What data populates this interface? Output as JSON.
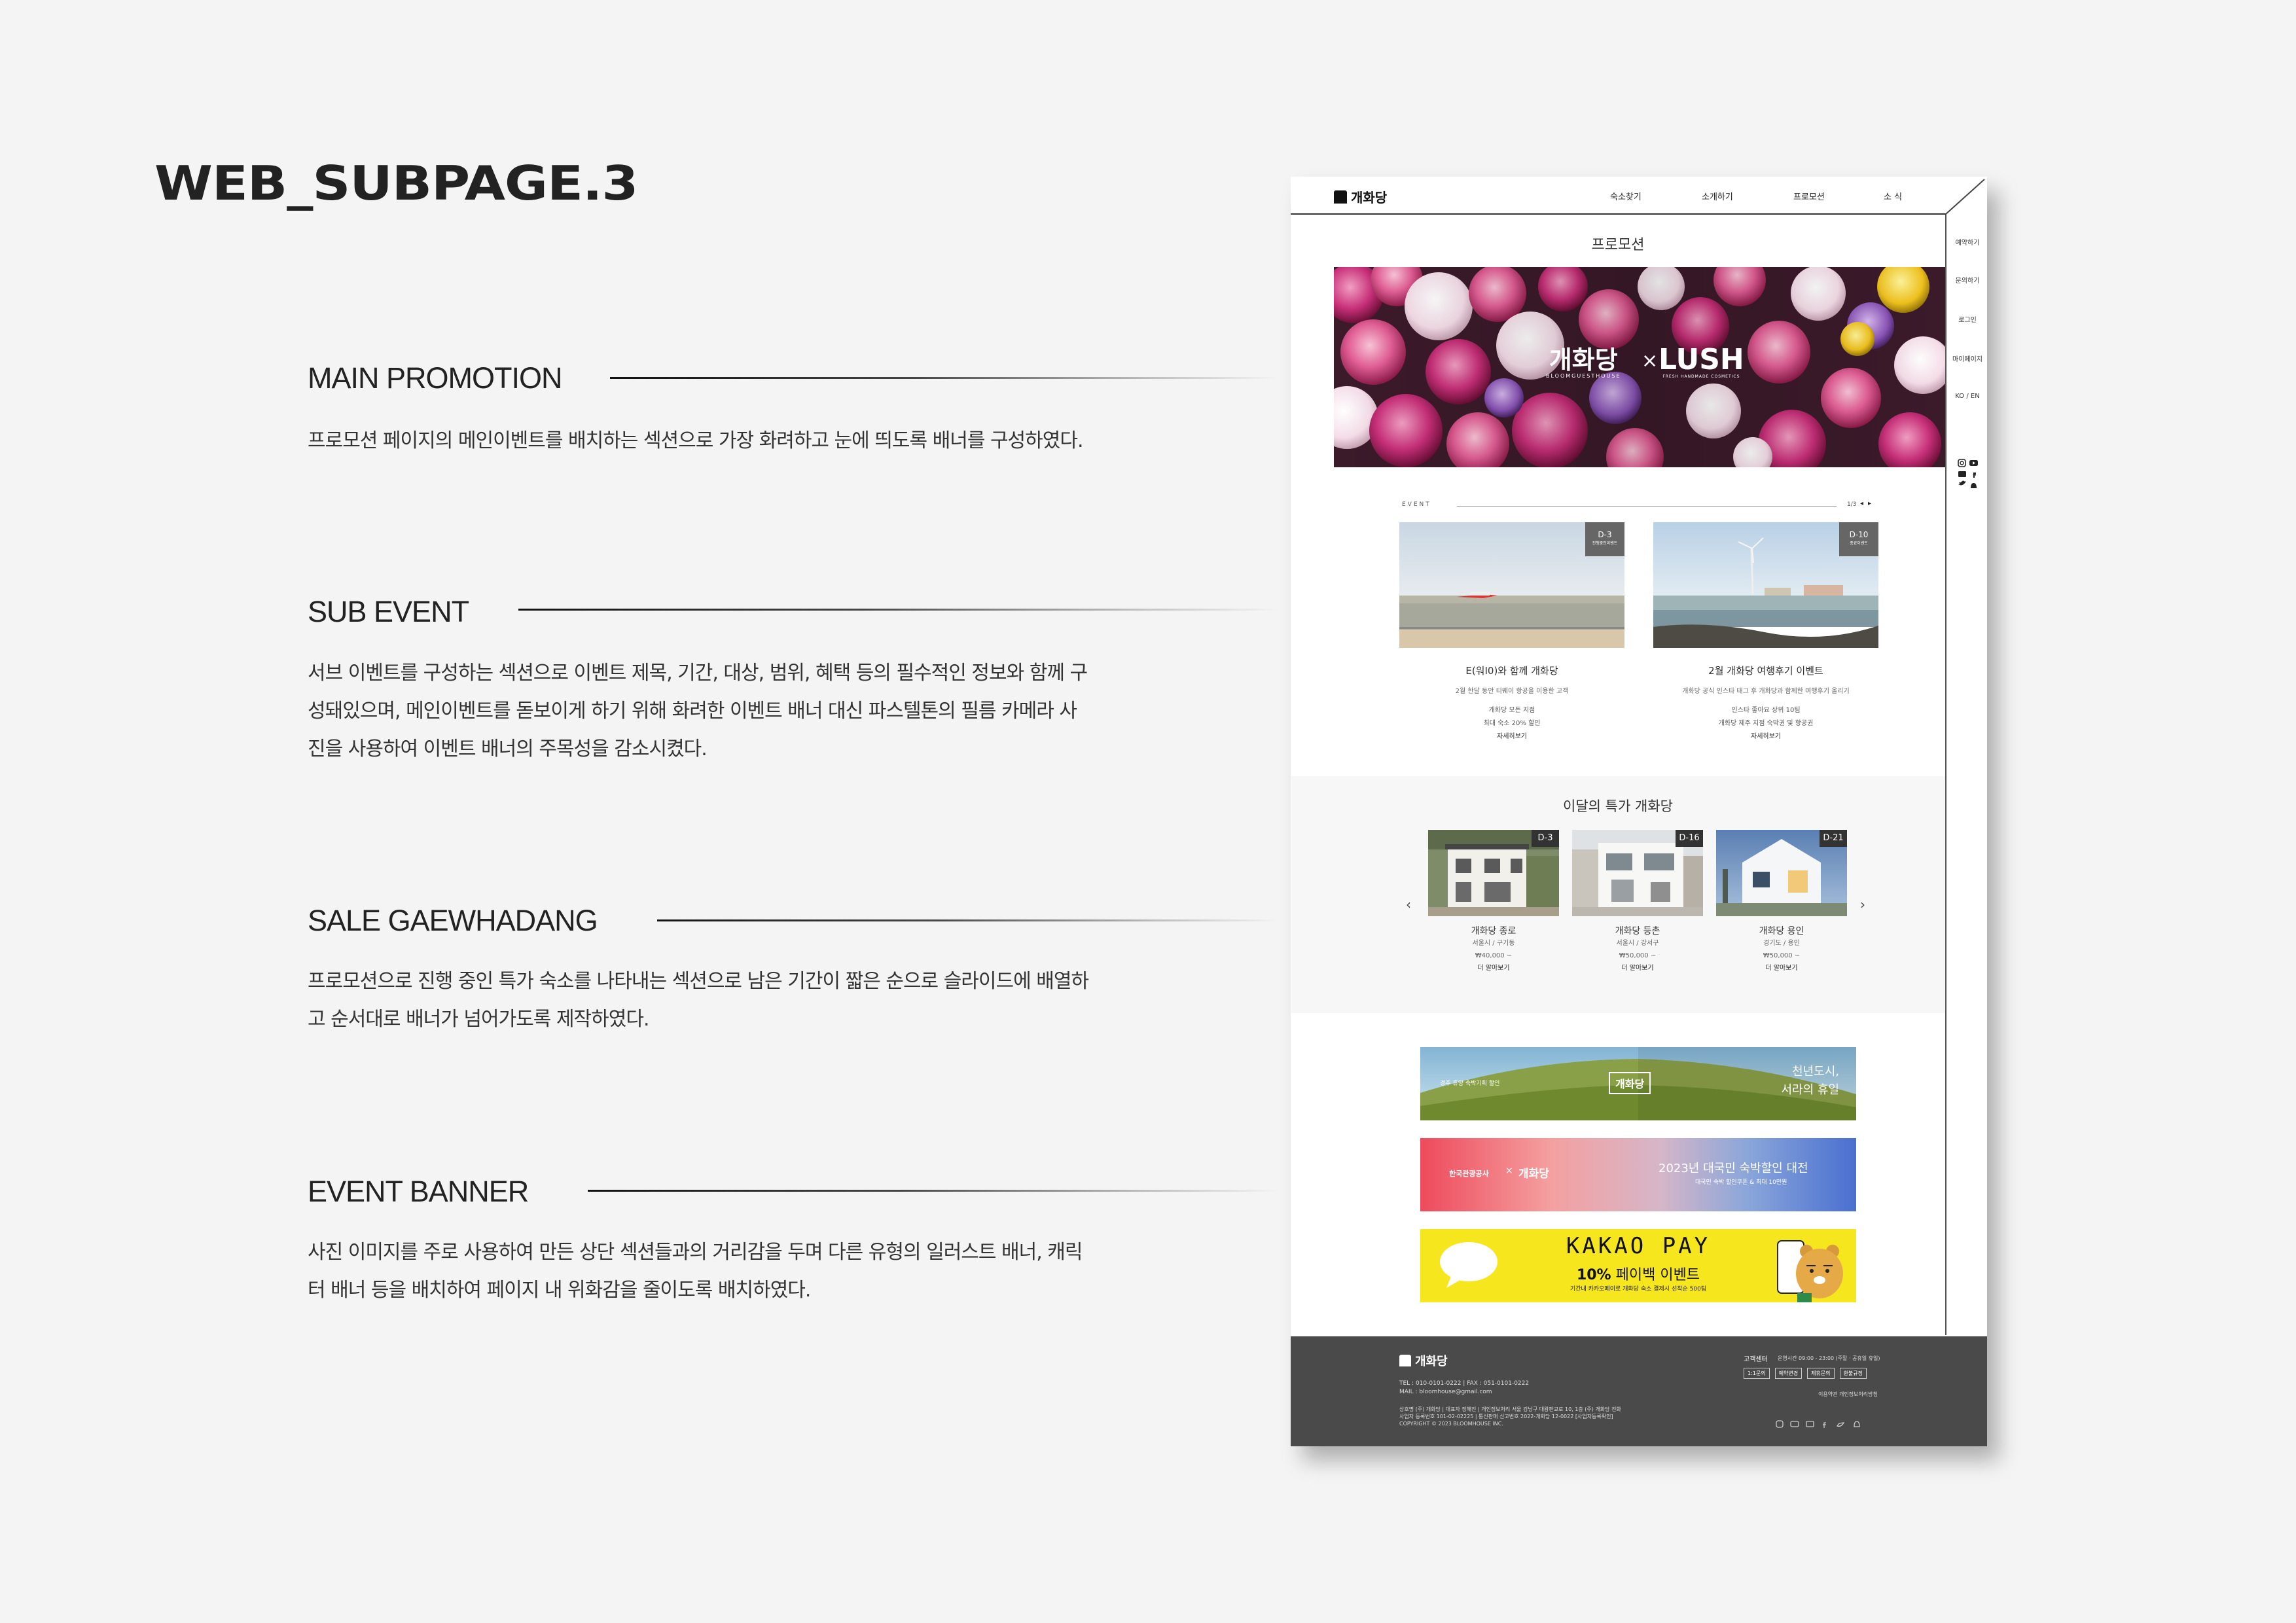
{
  "presentation": {
    "title": "WEB_SUBPAGE.3",
    "sections": [
      {
        "title": "MAIN PROMOTION",
        "desc": "프로모션 페이지의 메인이벤트를 배치하는 섹션으로 가장 화려하고 눈에 띄도록 배너를 구성하였다."
      },
      {
        "title": "SUB EVENT",
        "desc": "서브 이벤트를 구성하는 섹션으로 이벤트 제목, 기간, 대상, 범위, 혜택 등의 필수적인 정보와 함께 구성돼있으며, 메인이벤트를 돋보이게 하기 위해 화려한 이벤트 배너 대신 파스텔톤의 필름 카메라 사진을 사용하여 이벤트 배너의 주목성을 감소시켰다."
      },
      {
        "title": "SALE GAEWHADANG",
        "desc": "프로모션으로 진행 중인 특가 숙소를 나타내는 섹션으로 남은 기간이 짧은 순으로 슬라이드에 배열하고 순서대로 배너가 넘어가도록 제작하였다."
      },
      {
        "title": "EVENT BANNER",
        "desc": "사진 이미지를 주로 사용하여 만든 상단 섹션들과의 거리감을 두며 다른 유형의 일러스트 배너, 캐릭터 배너 등을 배치하여 페이지 내 위화감을 줄이도록 배치하였다."
      }
    ]
  },
  "mockup": {
    "logo": "개화당",
    "nav": [
      "숙소찾기",
      "소개하기",
      "프로모션",
      "소 식"
    ],
    "side_menu": [
      "예약하기",
      "문의하기",
      "로그인",
      "마이페이지",
      "KO / EN"
    ],
    "promo_heading": "프로모션",
    "hero": {
      "brand_left": "개화당",
      "brand_left_sub": "BLOOMGUESTHOUSE",
      "cross": "×",
      "brand_right": "LUSH",
      "brand_right_sub": "FRESH HANDMADE COSMETICS"
    },
    "event_label": "EVENT",
    "event_pager": "1/3",
    "events": [
      {
        "dday": "D-3",
        "dday_sub": "진행중인이벤트",
        "title": "E(워I0)와 함께 개화당",
        "sub": "2월 한달 동안 티웨이 항공을 이용한 고객",
        "info": [
          "개화당 모든 지점",
          "최대 숙소 20% 할인"
        ],
        "more": "자세히보기"
      },
      {
        "dday": "D-10",
        "dday_sub": "종료이벤트",
        "title": "2월 개화당 여행후기 이벤트",
        "sub": "개화당 공식 인스타 태그 후 개화당과 함께한 여행후기 올리기",
        "info": [
          "인스타 좋아요 상위 10팀",
          "개화당 제주 지점 숙박권 및 항공권"
        ],
        "more": "자세히보기"
      }
    ],
    "sale_heading": "이달의 특가 개화당",
    "sales": [
      {
        "dday": "D-3",
        "name": "개화당 종로",
        "loc": "서울시 / 구기동",
        "price": "₩40,000 ~",
        "more": "더 알아보기"
      },
      {
        "dday": "D-16",
        "name": "개화당 등촌",
        "loc": "서울시 / 강서구",
        "price": "₩50,000 ~",
        "more": "더 알아보기"
      },
      {
        "dday": "D-21",
        "name": "개화당 용인",
        "loc": "경기도 / 용인",
        "price": "₩50,000 ~",
        "more": "더 알아보기"
      }
    ],
    "banners": {
      "b1": {
        "left": "경주 휴양 숙박기획 할인",
        "logo": "개화당",
        "right1": "천년도시,",
        "right2": "서라의 휴일"
      },
      "b2": {
        "left": "한국관광공사",
        "cross": "×",
        "logo": "개화당",
        "title": "2023년 대국민 숙박할인 대전",
        "sub": "대국민 숙박 할인쿠폰 & 최대 10만원"
      },
      "b3": {
        "title": "KAKAO PAY",
        "sub_bold": "10%",
        "sub": "페이백 이벤트",
        "small": "기간내 카카오페이로 개화당 숙소 결제시 선착순 500팀"
      }
    },
    "footer": {
      "logo": "개화당",
      "contact1": "TEL : 010-0101-0222  |  FAX : 051-0101-0222",
      "contact2": "MAIL : bloomhouse@gmail.com",
      "legal": [
        "상호명 (주) 개화당  |  대표자 정해진  |  개인정보처리 서울 강남구 대왕판교로 10, 1층 (주) 개화당 전화",
        "사업자 등록번호 101-02-02225  |  통신판매 신고번호 2022-개화당 12-0022 [사업자등록확인]",
        "COPYRIGHT © 2023 BLOOMHOUSE INC."
      ],
      "cs_label": "고객센터",
      "cs_hours": "운영시간 09:00 - 23:00 (주말 · 공휴일 휴일)",
      "cs_buttons": [
        "1:1문의",
        "예약변경",
        "제휴문의",
        "환불규정"
      ],
      "links": "이용약관   개인정보처리방침"
    }
  }
}
